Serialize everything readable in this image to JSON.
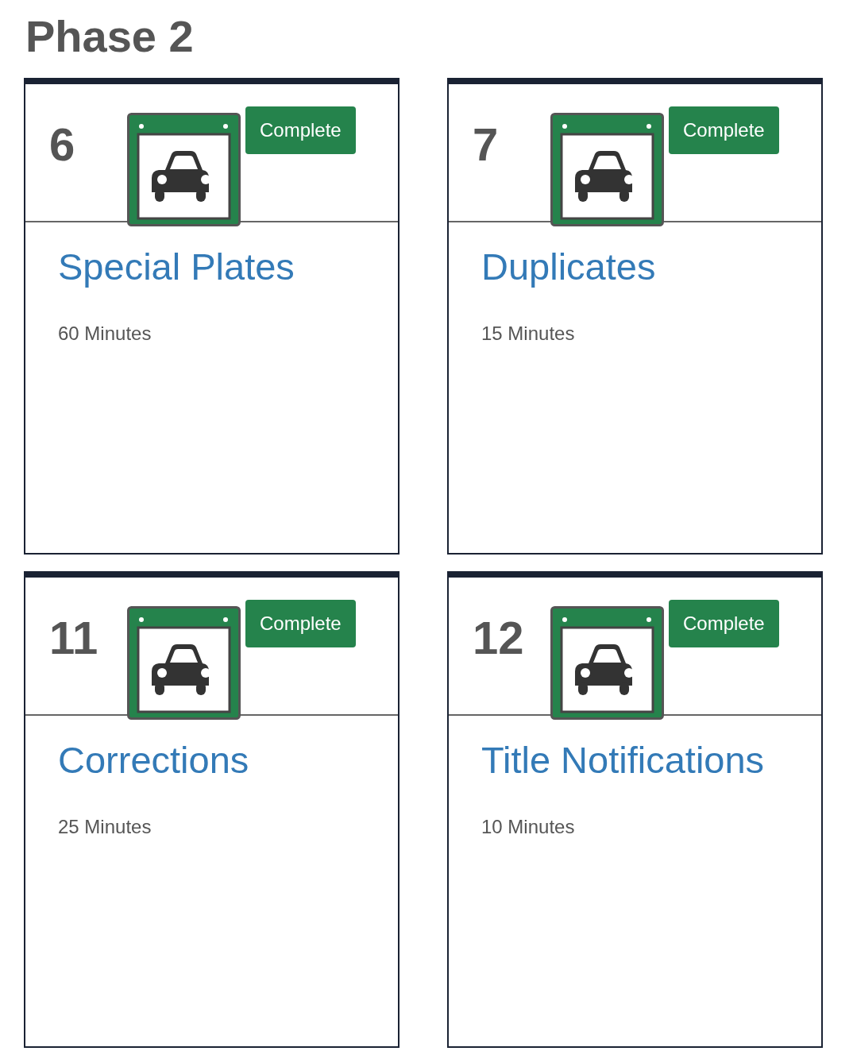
{
  "heading": "Phase 2",
  "cards": [
    {
      "number": "6",
      "badge": "Complete",
      "title": "Special Plates",
      "duration": "60 Minutes"
    },
    {
      "number": "7",
      "badge": "Complete",
      "title": "Duplicates",
      "duration": "15 Minutes"
    },
    {
      "number": "11",
      "badge": "Complete",
      "title": "Corrections",
      "duration": "25 Minutes"
    },
    {
      "number": "12",
      "badge": "Complete",
      "title": "Title Notifications",
      "duration": "10 Minutes"
    }
  ]
}
